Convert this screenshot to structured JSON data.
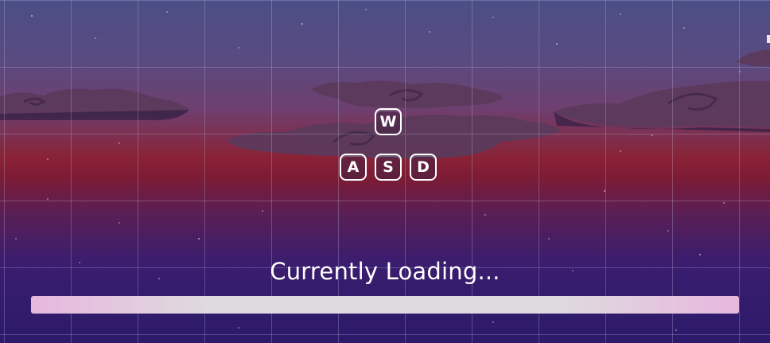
{
  "loading": {
    "text": "Currently Loading...",
    "progress": 1.0
  },
  "controls": {
    "keys": [
      "W",
      "A",
      "S",
      "D"
    ]
  },
  "colors": {
    "sky_top": "#4a4f86",
    "horizon": "#8a2236",
    "sky_bottom": "#2c1a6a",
    "cloud": "#5a3a5e",
    "progress_bar": "#dcd5dc",
    "text": "#ffffff"
  }
}
